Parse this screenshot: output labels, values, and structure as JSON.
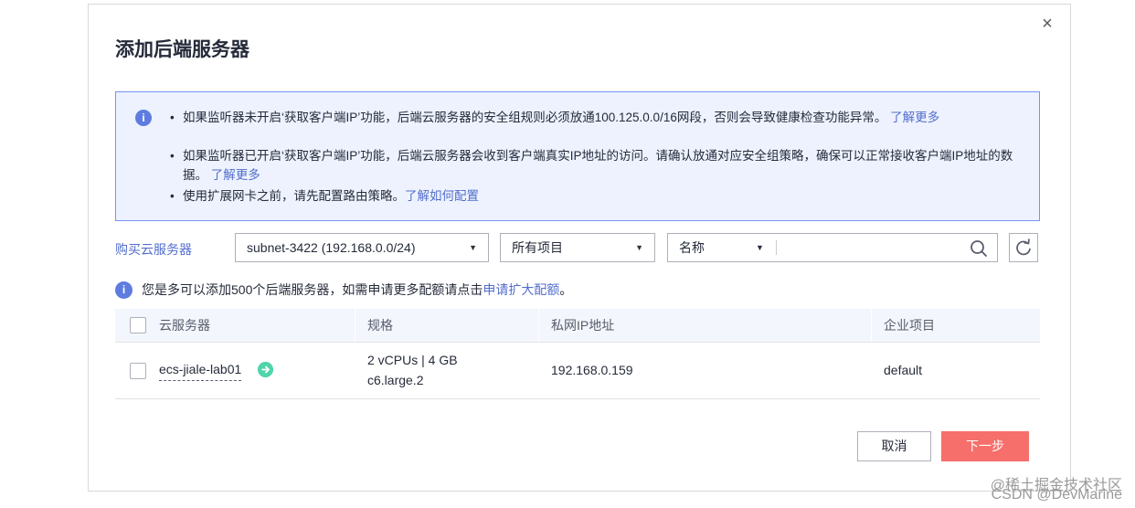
{
  "dialog": {
    "title": "添加后端服务器",
    "close_symbol": "×"
  },
  "notice": {
    "line1_text": "如果监听器未开启‘获取客户端IP’功能，后端云服务器的安全组规则必须放通100.125.0.0/16网段，否则会导致健康检查功能异常。",
    "line1_link": "了解更多",
    "line2_text": "如果监听器已开启‘获取客户端IP’功能，后端云服务器会收到客户端真实IP地址的访问。请确认放通对应安全组策略，确保可以正常接收客户端IP地址的数据。",
    "line2_link": "了解更多",
    "line3_text": "使用扩展网卡之前，请先配置路由策略。",
    "line3_link": "了解如何配置"
  },
  "toolbar": {
    "buy_link": "购买云服务器",
    "subnet_select": "subnet-3422 (192.168.0.0/24)",
    "project_select": "所有项目",
    "search_category": "名称",
    "search_placeholder": ""
  },
  "quota": {
    "text": "您是多可以添加500个后端服务器，如需申请更多配额请点击",
    "link": "申请扩大配额",
    "suffix": "。"
  },
  "table": {
    "headers": [
      "云服务器",
      "规格",
      "私网IP地址",
      "企业项目"
    ],
    "rows": [
      {
        "name": "ecs-jiale-lab01",
        "spec_line1": "2 vCPUs | 4 GB",
        "spec_line2": "c6.large.2",
        "ip": "192.168.0.159",
        "project": "default"
      }
    ]
  },
  "footer": {
    "cancel_label": "取消",
    "next_label": "下一步"
  },
  "watermark": {
    "line1": "@稀土掘金技术社区",
    "line2": "CSDN @DevMarine"
  },
  "colors": {
    "link": "#526ecc",
    "primary_danger": "#f66f6a",
    "notice_border": "#7693f5",
    "notice_bg": "#edf2fe"
  }
}
